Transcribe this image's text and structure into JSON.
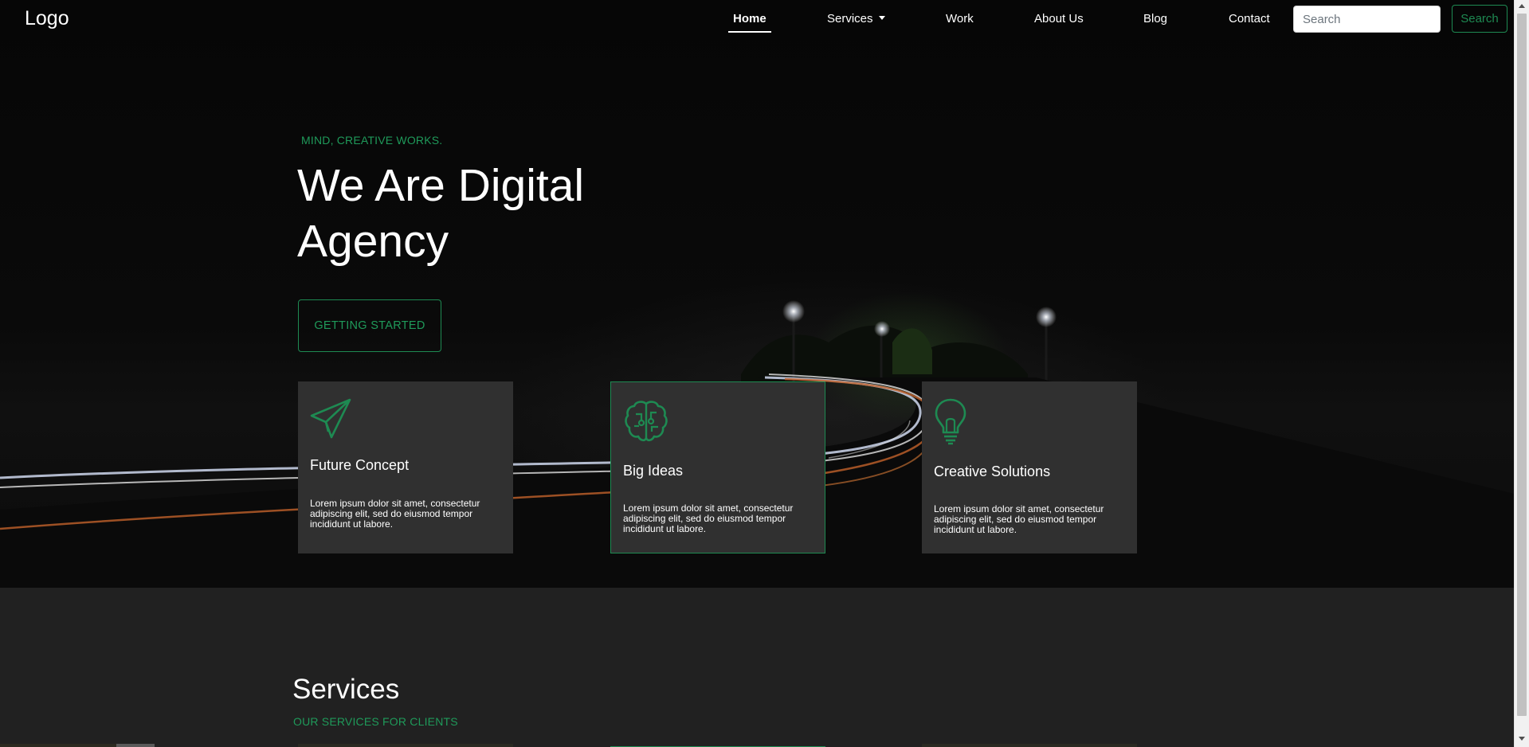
{
  "navbar": {
    "logo": "Logo",
    "links": [
      {
        "label": "Home",
        "active": true
      },
      {
        "label": "Services",
        "dropdown": true
      },
      {
        "label": "Work"
      },
      {
        "label": "About Us"
      },
      {
        "label": "Blog"
      },
      {
        "label": "Contact"
      }
    ],
    "search_placeholder": "Search",
    "search_button": "Search"
  },
  "hero": {
    "tagline": "MIND, CREATIVE WORKS.",
    "title": "We Are Digital Agency",
    "cta": "GETTING STARTED"
  },
  "features": [
    {
      "icon": "paper-plane-icon",
      "title": "Future Concept",
      "text": "Lorem ipsum dolor sit amet, consectetur adipiscing elit, sed do eiusmod tempor incididunt ut labore.",
      "highlighted": false
    },
    {
      "icon": "brain-icon",
      "title": "Big Ideas",
      "text": "Lorem ipsum dolor sit amet, consectetur adipiscing elit, sed do eiusmod tempor incididunt ut labore.",
      "highlighted": true
    },
    {
      "icon": "lightbulb-icon",
      "title": "Creative Solutions",
      "text": "Lorem ipsum dolor sit amet, consectetur adipiscing elit, sed do eiusmod tempor incididunt ut labore.",
      "highlighted": false
    }
  ],
  "services": {
    "title": "Services",
    "subtitle": "OUR SERVICES FOR CLIENTS"
  },
  "colors": {
    "accent": "#1e8a52",
    "hero_bg": "#050505",
    "card_bg": "#303030",
    "section_bg": "#212121"
  }
}
